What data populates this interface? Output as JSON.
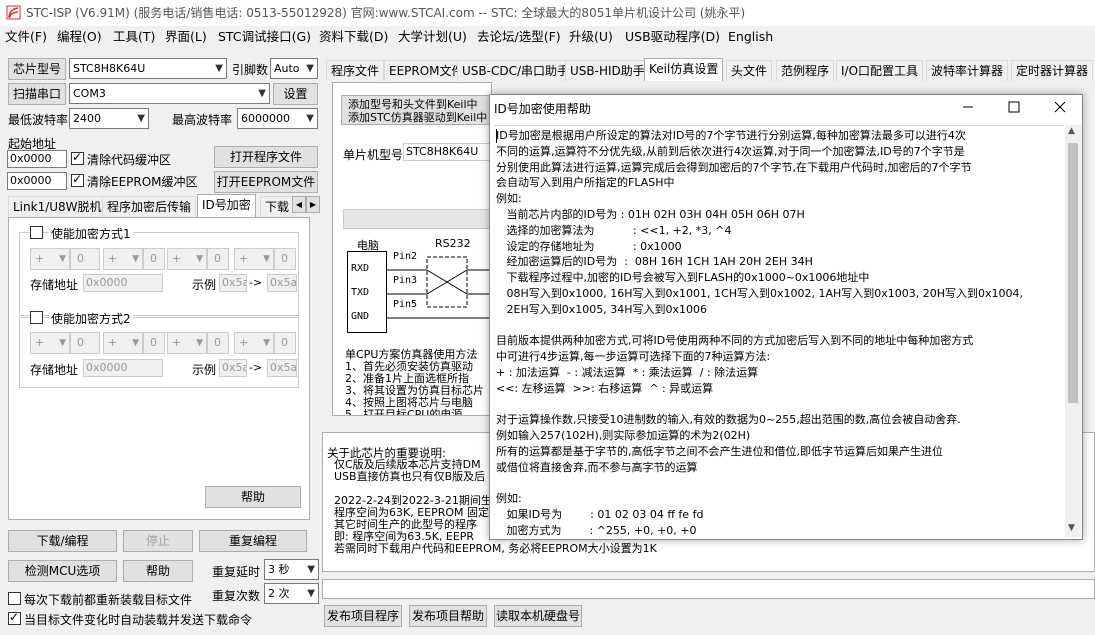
{
  "window": {
    "title": "STC-ISP (V6.91M) (服务电话/销售电话: 0513-55012928) 官网:www.STCAI.com  -- STC: 全球最大的8051单片机设计公司 (姚永平)"
  },
  "menu": [
    "文件(F)",
    "编程(O)",
    "工具(T)",
    "界面(L)",
    "STC调试接口(G)",
    "资料下载(D)",
    "大学计划(U)",
    "去论坛/选型(F)",
    "升级(U)",
    "USB驱动程序(D)",
    "English"
  ],
  "left": {
    "chip_label": "芯片型号",
    "chip_value": "STC8H8K64U",
    "pin_label": "引脚数",
    "pin_value": "Auto",
    "scan_button": "扫描串口",
    "port_value": "COM3",
    "settings_button": "设置",
    "minbaud_label": "最低波特率",
    "minbaud_value": "2400",
    "maxbaud_label": "最高波特率",
    "maxbaud_value": "6000000",
    "start_label": "起始地址",
    "addr1": "0x0000",
    "clear_code": "清除代码缓冲区",
    "open_program": "打开程序文件",
    "addr2": "0x0000",
    "clear_eeprom": "清除EEPROM缓冲区",
    "open_eeprom": "打开EEPROM文件",
    "tabs": [
      "Link1/U8W脱机",
      "程序加密后传输",
      "ID号加密",
      "下载"
    ],
    "enc1": "使能加密方式1",
    "enc2": "使能加密方式2",
    "seg_value": "0",
    "store_label": "存储地址",
    "store_value": "0x0000",
    "example_label": "示例",
    "ex_from": "0x5a",
    "ex_arrow": "->",
    "ex_to": "0x5a",
    "help_button": "帮助",
    "download_button": "下载/编程",
    "stop_button": "停止",
    "reprogram_button": "重复编程",
    "detect_button": "检测MCU选项",
    "help2_button": "帮助",
    "repeat_delay_label": "重复延时",
    "repeat_delay_value": "3 秒",
    "repeat_count_label": "重复次数",
    "repeat_count_value": "2 次",
    "reload_each": "每次下载前都重新装载目标文件",
    "auto_send": "当目标文件变化时自动装载并发送下载命令"
  },
  "right": {
    "tabs": [
      "程序文件",
      "EEPROM文件",
      "USB-CDC/串口助手",
      "USB-HID助手",
      "Keil仿真设置",
      "头文件",
      "范例程序",
      "I/O口配置工具",
      "波特率计算器",
      "定时器计算器"
    ],
    "add_btn1": "添加型号和头文件到Keil中",
    "add_btn2": "添加STC仿真器驱动到Keil中",
    "chip_label": "单片机型号",
    "chip_value": "STC8H8K64U",
    "diag_pc": "电脑",
    "diag_rs232": "RS232",
    "diag_rxd": "RXD",
    "diag_txd": "TXD",
    "diag_gnd": "GND",
    "diag_pin2": "Pin2",
    "diag_pin3": "Pin3",
    "diag_pin5": "Pin5",
    "method_lines": [
      "单CPU方案仿真器使用方法",
      "1、首先必须安装仿真驱动",
      "2、准备1片上面选框所指",
      "3、将其设置为仿真目标芯片",
      "4、按照上图将芯片与电脑",
      "5、打开目标CPU的电源"
    ],
    "info_lines": [
      "关于此芯片的重要说明:",
      "  仅C版及后续版本芯片支持DM",
      "  USB直接仿真也只有仅B版及后",
      "",
      "  2022-2-24到2022-3-21期间生",
      "  程序空间为63K, EEPROM 固定",
      "  其它时间生产的此型号的程序",
      "  即: 程序空间为63.5K, EEPR",
      "  若需同时下载用户代码和EEPROM, 务必将EEPROM大小设置为1K"
    ],
    "btn_publish": "发布项目程序",
    "btn_publish_help": "发布项目帮助",
    "btn_read_disk": "读取本机硬盘号"
  },
  "dialog": {
    "title": "ID号加密使用帮助",
    "lines": [
      "ID号加密是根据用户所设定的算法对ID号的7个字节进行分别运算,每种加密算法最多可以进行4次",
      "不同的运算,运算符不分优先级,从前到后依次进行4次运算,对于同一个加密算法,ID号的7个字节是",
      "分别使用此算法进行运算,运算完成后会得到加密后的7个字节,在下载用户代码时,加密后的7个字节",
      "会自动写入到用户所指定的FLASH中",
      "例如:",
      "   当前芯片内部的ID号为 : 01H 02H 03H 04H 05H 06H 07H",
      "   选择的加密算法为           : <<1, +2, *3, ^4",
      "   设定的存储地址为           : 0x1000",
      "   经加密运算后的ID号为  :  08H 16H 1CH 1AH 20H 2EH 34H",
      "   下载程序过程中,加密的ID号会被写入到FLASH的0x1000~0x1006地址中",
      "   08H写入到0x1000, 16H写入到0x1001, 1CH写入到0x1002, 1AH写入到0x1003, 20H写入到0x1004,",
      "   2EH写入到0x1005, 34H写入到0x1006",
      "",
      "目前版本提供两种加密方式,可将ID号使用两种不同的方式加密后写入到不同的地址中每种加密方式",
      "中可进行4步运算,每一步运算可选择下面的7种运算方法:",
      "+ : 加法运算  - : 减法运算  * : 乘法运算  / : 除法运算",
      "<<: 左移运算  >>: 右移运算  ^ : 异或运算",
      "",
      "对于运算操作数,只接受10进制数的输入,有效的数据为0~255,超出范围的数,高位会被自动舍弃.",
      "例如输入257(102H),则实际参加运算的术为2(02H)",
      "所有的运算都是基于字节的,高低字节之间不会产生进位和借位,即低字节运算后如果产生进位",
      "或借位将直接舍弃,而不参与高字节的运算",
      "",
      "例如:",
      "   如果ID号为        : 01 02 03 04 ff fe fd",
      "   加密方式为        : ^255, +0, +0, +0"
    ]
  },
  "colors": {
    "accent": "#0078d7",
    "window_bg": "#f0f0f0"
  }
}
